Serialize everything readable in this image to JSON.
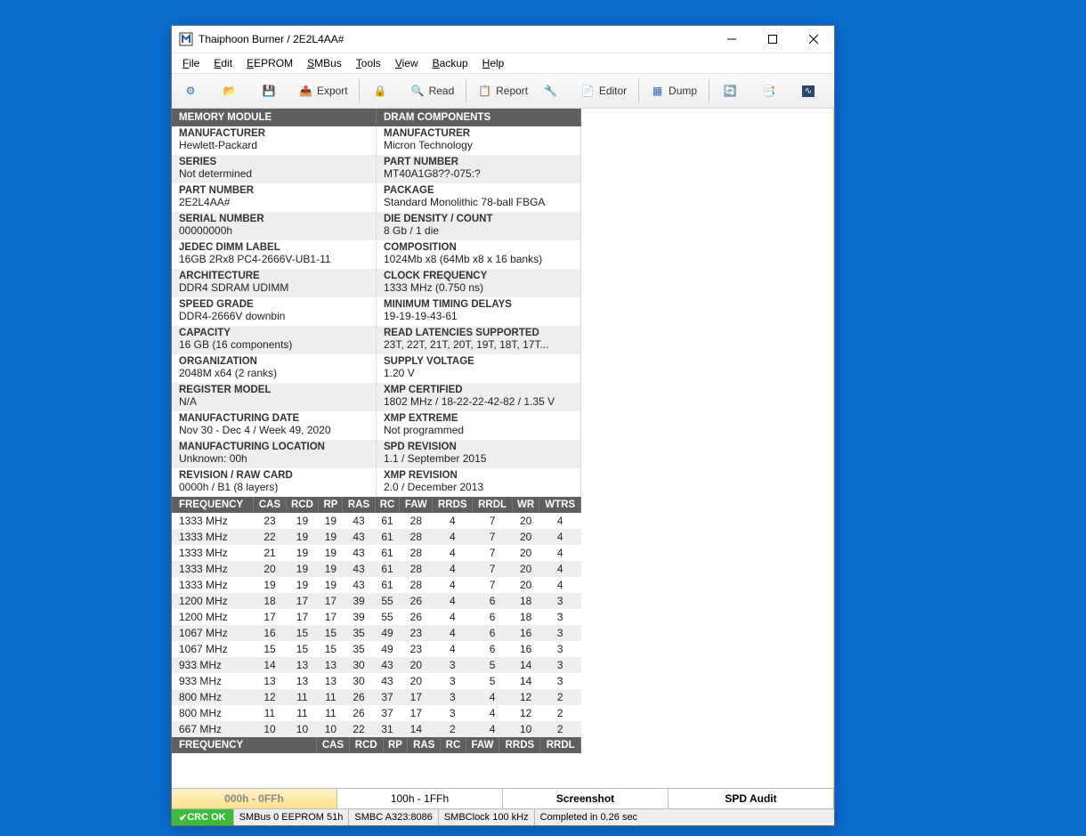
{
  "window_title": "Thaiphoon Burner / 2E2L4AA#",
  "menu": [
    "File",
    "Edit",
    "EEPROM",
    "SMBus",
    "Tools",
    "View",
    "Backup",
    "Help"
  ],
  "toolbar": {
    "export": "Export",
    "read": "Read",
    "report": "Report",
    "editor": "Editor",
    "dump": "Dump"
  },
  "panels": {
    "left": {
      "title": "MEMORY MODULE",
      "rows": [
        {
          "k": "MANUFACTURER",
          "v": "Hewlett-Packard"
        },
        {
          "k": "SERIES",
          "v": "Not determined"
        },
        {
          "k": "PART NUMBER",
          "v": "2E2L4AA#"
        },
        {
          "k": "SERIAL NUMBER",
          "v": "00000000h"
        },
        {
          "k": "JEDEC DIMM LABEL",
          "v": "16GB 2Rx8 PC4-2666V-UB1-11"
        },
        {
          "k": "ARCHITECTURE",
          "v": "DDR4 SDRAM UDIMM"
        },
        {
          "k": "SPEED GRADE",
          "v": "DDR4-2666V downbin"
        },
        {
          "k": "CAPACITY",
          "v": "16 GB (16 components)"
        },
        {
          "k": "ORGANIZATION",
          "v": "2048M x64 (2 ranks)"
        },
        {
          "k": "REGISTER MODEL",
          "v": "N/A"
        },
        {
          "k": "MANUFACTURING DATE",
          "v": "Nov 30 - Dec 4 / Week 49, 2020"
        },
        {
          "k": "MANUFACTURING LOCATION",
          "v": "Unknown: 00h"
        },
        {
          "k": "REVISION / RAW CARD",
          "v": "0000h / B1 (8 layers)"
        }
      ]
    },
    "right": {
      "title": "DRAM COMPONENTS",
      "rows": [
        {
          "k": "MANUFACTURER",
          "v": "Micron Technology"
        },
        {
          "k": "PART NUMBER",
          "v": "MT40A1G8??-075:?"
        },
        {
          "k": "PACKAGE",
          "v": "Standard Monolithic 78-ball FBGA"
        },
        {
          "k": "DIE DENSITY / COUNT",
          "v": "8 Gb / 1 die"
        },
        {
          "k": "COMPOSITION",
          "v": "1024Mb x8 (64Mb x8 x 16 banks)"
        },
        {
          "k": "CLOCK FREQUENCY",
          "v": "1333 MHz (0.750 ns)"
        },
        {
          "k": "MINIMUM TIMING DELAYS",
          "v": "19-19-19-43-61"
        },
        {
          "k": "READ LATENCIES SUPPORTED",
          "v": "23T, 22T, 21T, 20T, 19T, 18T, 17T..."
        },
        {
          "k": "SUPPLY VOLTAGE",
          "v": "1.20 V"
        },
        {
          "k": "XMP CERTIFIED",
          "v": "1802 MHz / 18-22-22-42-82 / 1.35 V"
        },
        {
          "k": "XMP EXTREME",
          "v": "Not programmed"
        },
        {
          "k": "SPD REVISION",
          "v": "1.1 / September 2015"
        },
        {
          "k": "XMP REVISION",
          "v": "2.0 / December 2013"
        }
      ]
    }
  },
  "freq": {
    "cols": [
      "FREQUENCY",
      "CAS",
      "RCD",
      "RP",
      "RAS",
      "RC",
      "FAW",
      "RRDS",
      "RRDL",
      "WR",
      "WTRS"
    ],
    "rows": [
      [
        "1333 MHz",
        "23",
        "19",
        "19",
        "43",
        "61",
        "28",
        "4",
        "7",
        "20",
        "4"
      ],
      [
        "1333 MHz",
        "22",
        "19",
        "19",
        "43",
        "61",
        "28",
        "4",
        "7",
        "20",
        "4"
      ],
      [
        "1333 MHz",
        "21",
        "19",
        "19",
        "43",
        "61",
        "28",
        "4",
        "7",
        "20",
        "4"
      ],
      [
        "1333 MHz",
        "20",
        "19",
        "19",
        "43",
        "61",
        "28",
        "4",
        "7",
        "20",
        "4"
      ],
      [
        "1333 MHz",
        "19",
        "19",
        "19",
        "43",
        "61",
        "28",
        "4",
        "7",
        "20",
        "4"
      ],
      [
        "1200 MHz",
        "18",
        "17",
        "17",
        "39",
        "55",
        "26",
        "4",
        "6",
        "18",
        "3"
      ],
      [
        "1200 MHz",
        "17",
        "17",
        "17",
        "39",
        "55",
        "26",
        "4",
        "6",
        "18",
        "3"
      ],
      [
        "1067 MHz",
        "16",
        "15",
        "15",
        "35",
        "49",
        "23",
        "4",
        "6",
        "16",
        "3"
      ],
      [
        "1067 MHz",
        "15",
        "15",
        "15",
        "35",
        "49",
        "23",
        "4",
        "6",
        "16",
        "3"
      ],
      [
        "933 MHz",
        "14",
        "13",
        "13",
        "30",
        "43",
        "20",
        "3",
        "5",
        "14",
        "3"
      ],
      [
        "933 MHz",
        "13",
        "13",
        "13",
        "30",
        "43",
        "20",
        "3",
        "5",
        "14",
        "3"
      ],
      [
        "800 MHz",
        "12",
        "11",
        "11",
        "26",
        "37",
        "17",
        "3",
        "4",
        "12",
        "2"
      ],
      [
        "800 MHz",
        "11",
        "11",
        "11",
        "26",
        "37",
        "17",
        "3",
        "4",
        "12",
        "2"
      ],
      [
        "667 MHz",
        "10",
        "10",
        "10",
        "22",
        "31",
        "14",
        "2",
        "4",
        "10",
        "2"
      ]
    ],
    "cols2": [
      "FREQUENCY",
      "CAS",
      "RCD",
      "RP",
      "RAS",
      "RC",
      "FAW",
      "RRDS",
      "RRDL"
    ]
  },
  "tabs": [
    "000h - 0FFh",
    "100h - 1FFh",
    "Screenshot",
    "SPD Audit"
  ],
  "status": {
    "crc": "CRC OK",
    "smbus": "SMBus 0 EEPROM 51h",
    "smbc": "SMBC A323:8086",
    "clock": "SMBClock 100 kHz",
    "time": "Completed in 0.26 sec"
  }
}
